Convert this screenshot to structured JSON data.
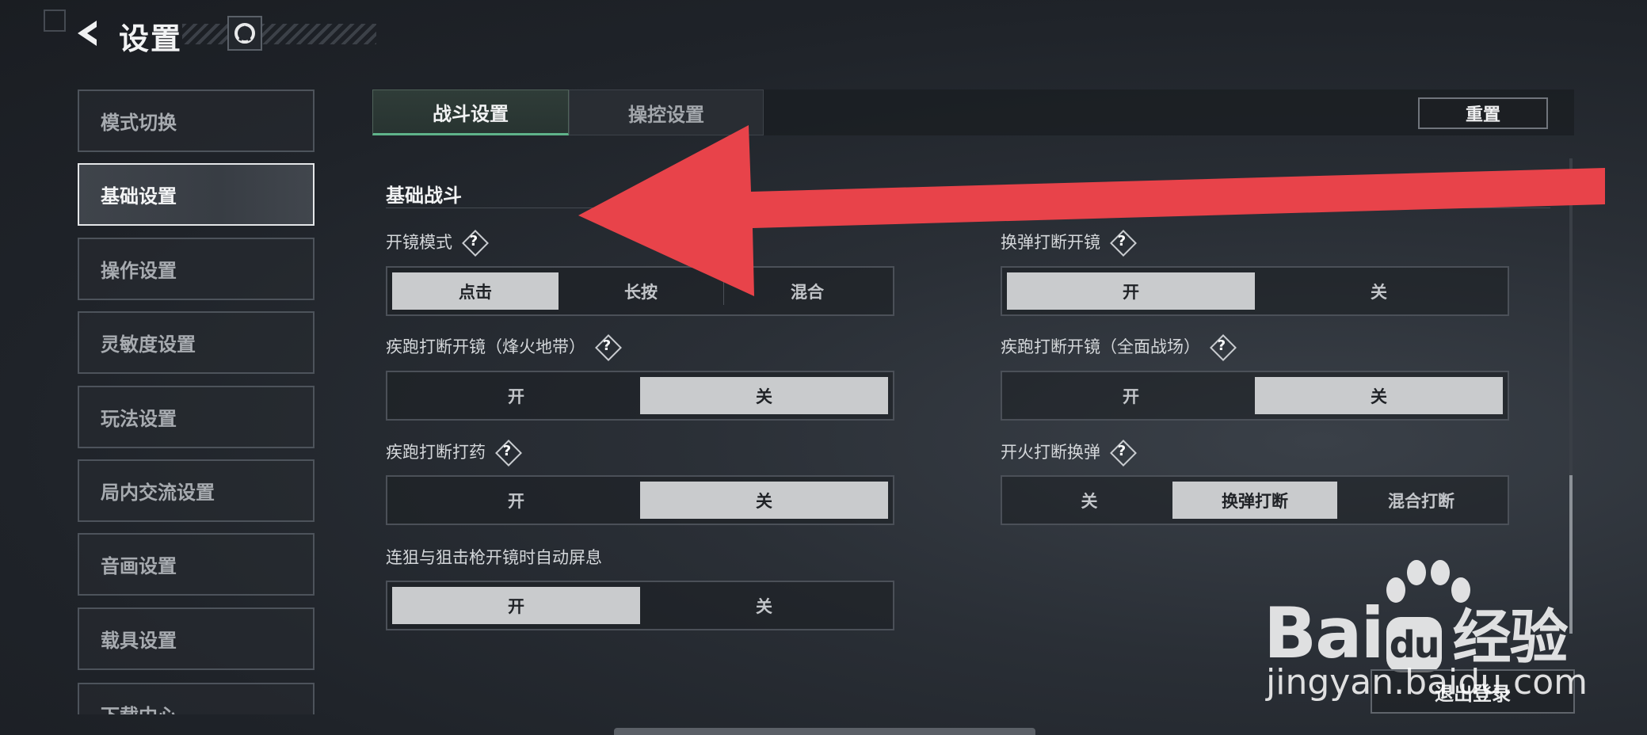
{
  "header": {
    "title": "设置"
  },
  "sidebar": {
    "items": [
      {
        "label": "模式切换",
        "active": false
      },
      {
        "label": "基础设置",
        "active": true
      },
      {
        "label": "操作设置",
        "active": false
      },
      {
        "label": "灵敏度设置",
        "active": false
      },
      {
        "label": "玩法设置",
        "active": false
      },
      {
        "label": "局内交流设置",
        "active": false
      },
      {
        "label": "音画设置",
        "active": false
      },
      {
        "label": "载具设置",
        "active": false
      },
      {
        "label": "下载中心",
        "active": false
      }
    ]
  },
  "tabs": [
    {
      "label": "战斗设置",
      "active": true
    },
    {
      "label": "操控设置",
      "active": false
    }
  ],
  "toolbar": {
    "reset_label": "重置"
  },
  "section": {
    "title": "基础战斗",
    "settings": [
      {
        "label": "开镜模式",
        "help": "?",
        "options": [
          "点击",
          "长按",
          "混合"
        ],
        "selected": "点击"
      },
      {
        "label": "换弹打断开镜",
        "help": "?",
        "options": [
          "开",
          "关"
        ],
        "selected": "开"
      },
      {
        "label": "疾跑打断开镜（烽火地带）",
        "help": "?",
        "options": [
          "开",
          "关"
        ],
        "selected": "关"
      },
      {
        "label": "疾跑打断开镜（全面战场）",
        "help": "?",
        "options": [
          "开",
          "关"
        ],
        "selected": "关"
      },
      {
        "label": "疾跑打断打药",
        "help": "?",
        "options": [
          "开",
          "关"
        ],
        "selected": "关"
      },
      {
        "label": "开火打断换弹",
        "help": "?",
        "options": [
          "关",
          "换弹打断",
          "混合打断"
        ],
        "selected": "换弹打断"
      },
      {
        "label": "连狙与狙击枪开镜时自动屏息",
        "options": [
          "开",
          "关"
        ],
        "selected": "开"
      }
    ]
  },
  "footer": {
    "logout_label": "退出登录"
  },
  "watermark": {
    "brand_prefix": "Bai",
    "brand_du": "du",
    "brand_cn": "经验",
    "url": "jingyan.baidu.com"
  },
  "annotation": {
    "arrow_color": "#e8434a"
  },
  "colors": {
    "accent_green": "#5fb38a",
    "selected_bg": "#c9cbcd",
    "annotation_red": "#e8434a"
  }
}
